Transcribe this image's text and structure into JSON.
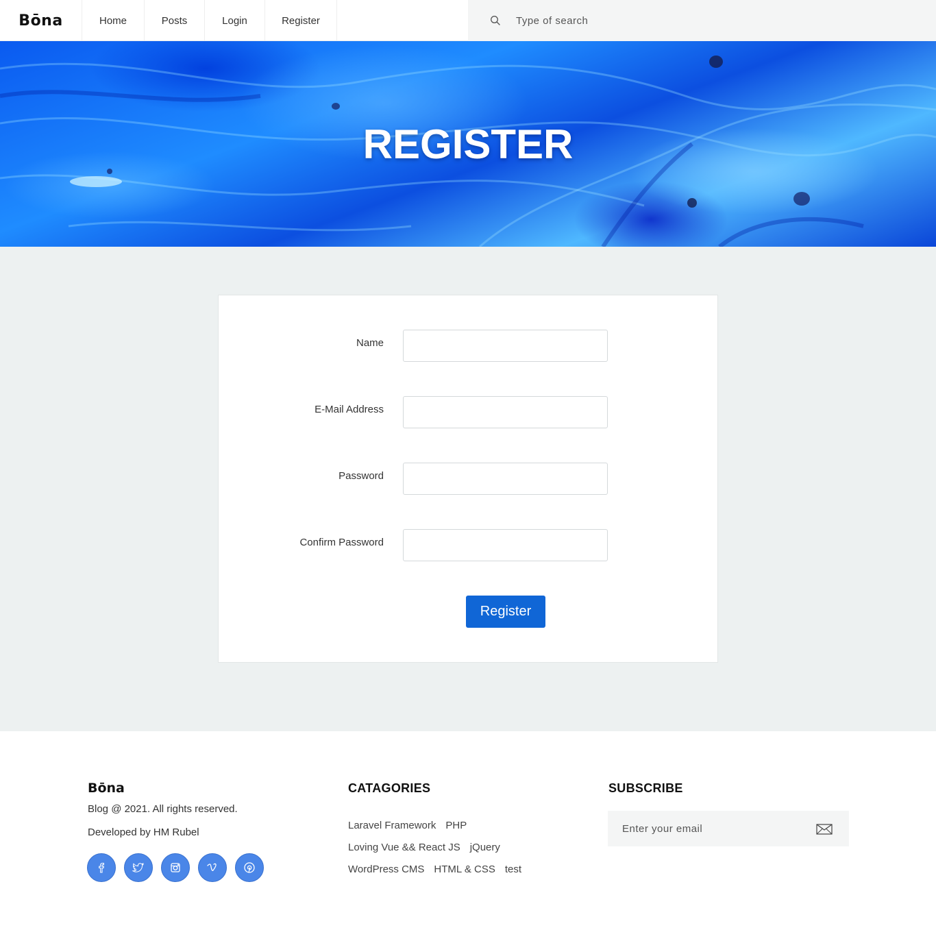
{
  "header": {
    "logo": "Bōna",
    "nav": [
      {
        "label": "Home"
      },
      {
        "label": "Posts"
      },
      {
        "label": "Login"
      },
      {
        "label": "Register"
      }
    ],
    "search": {
      "placeholder": "Type of search",
      "icon": "search-icon"
    }
  },
  "hero": {
    "title": "REGISTER"
  },
  "form": {
    "fields": [
      {
        "label": "Name",
        "value": ""
      },
      {
        "label": "E-Mail Address",
        "value": ""
      },
      {
        "label": "Password",
        "value": ""
      },
      {
        "label": "Confirm Password",
        "value": ""
      }
    ],
    "submit_label": "Register"
  },
  "footer": {
    "logo": "Bōna",
    "copyright": "Blog @ 2021. All rights reserved.",
    "developer": "Developed by HM Rubel",
    "socials": [
      "facebook-icon",
      "twitter-icon",
      "instagram-icon",
      "vimeo-icon",
      "pinterest-icon"
    ],
    "categories_title": "CATAGORIES",
    "categories": [
      "Laravel Framework",
      "PHP",
      "Loving Vue && React JS",
      "jQuery",
      "WordPress CMS",
      "HTML & CSS",
      "test"
    ],
    "subscribe_title": "SUBSCRIBE",
    "subscribe_placeholder": "Enter your email"
  },
  "colors": {
    "accent": "#1066d6",
    "social": "#4a86e8",
    "main_bg": "#edf1f1",
    "hero": "#1f8cff"
  }
}
